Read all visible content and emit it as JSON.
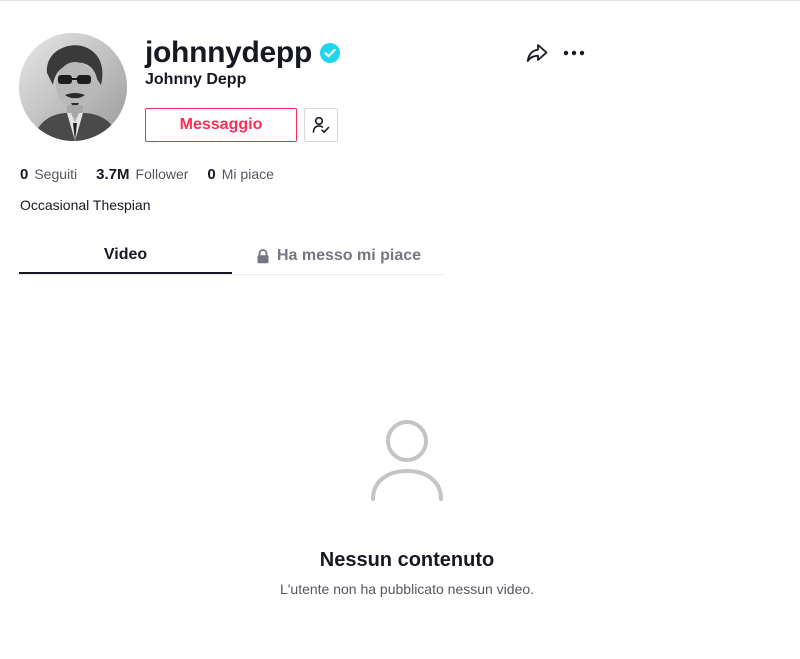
{
  "profile": {
    "username": "johnnydepp",
    "display_name": "Johnny Depp",
    "verified": true,
    "bio": "Occasional Thespian"
  },
  "actions": {
    "message_label": "Messaggio"
  },
  "stats": [
    {
      "value": "0",
      "label": "Seguiti"
    },
    {
      "value": "3.7M",
      "label": "Follower"
    },
    {
      "value": "0",
      "label": "Mi piace"
    }
  ],
  "tabs": [
    {
      "label": "Video",
      "active": true,
      "locked": false
    },
    {
      "label": "Ha messo mi piace",
      "active": false,
      "locked": true
    }
  ],
  "empty_state": {
    "title": "Nessun contenuto",
    "subtitle": "L'utente non ha pubblicato nessun video."
  },
  "colors": {
    "accent": "#fe2c55",
    "verified": "#20d5ec",
    "text": "#161823",
    "muted": "#555760"
  }
}
